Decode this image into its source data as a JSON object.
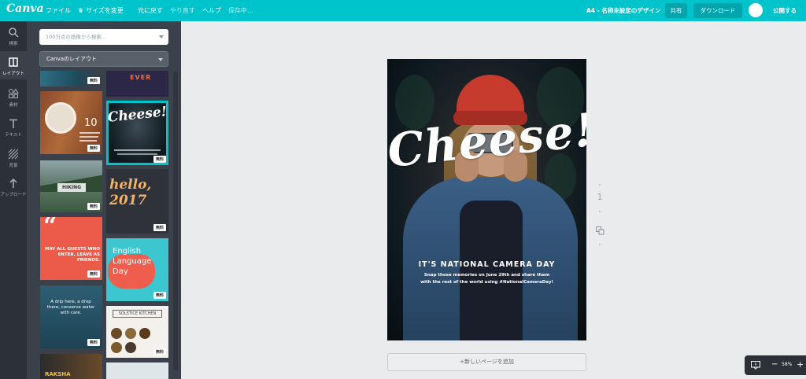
{
  "app": {
    "logo": "Canva"
  },
  "menu": {
    "file": "ファイル",
    "resize": "サイズを変更",
    "undo": "元に戻す",
    "redo": "やり直す",
    "help": "ヘルプ",
    "saving": "保存中..."
  },
  "header": {
    "doc_title": "A4 - 名称未設定のデザイン",
    "share": "共有",
    "download": "ダウンロード",
    "publish": "公開する"
  },
  "rail": [
    {
      "label": "検索",
      "icon": "search-icon"
    },
    {
      "label": "レイアウト",
      "icon": "layout-icon"
    },
    {
      "label": "素材",
      "icon": "elements-icon"
    },
    {
      "label": "テキスト",
      "icon": "text-icon"
    },
    {
      "label": "背景",
      "icon": "background-icon"
    },
    {
      "label": "アップロード",
      "icon": "upload-icon"
    }
  ],
  "panel": {
    "search_placeholder": "100万点の画像から検索...",
    "layout_select": "Canvaのレイアウト",
    "free_badge": "無料",
    "thumbs": {
      "ever": "EVER",
      "food_number": "10",
      "cheese": "Cheese!",
      "hiking": "HIKING",
      "hello": "hello, 2017",
      "quote": "MAY ALL GUESTS WHO ENTER, LEAVE AS FRIENDS.",
      "english": "English Language Day",
      "water": "A drip here, a drop there, conserve water with care.",
      "solstice": "SOLSTICE KITCHEN",
      "raksha": "RAKSHA"
    }
  },
  "canvas": {
    "headline": "Cheese!",
    "subtitle": "IT'S NATIONAL CAMERA DAY",
    "body_line1": "Snap those memories on June 29th and share them",
    "body_line2": "with the rest of the world using #NationalCameraDay!",
    "page_number": "1",
    "add_page": "+新しいページを追加"
  },
  "zoom": {
    "level": "58%",
    "minus": "−",
    "plus": "+"
  },
  "colors": {
    "brand": "#00c4cc",
    "sidebar": "#2c3138",
    "panel": "#3a414a"
  }
}
